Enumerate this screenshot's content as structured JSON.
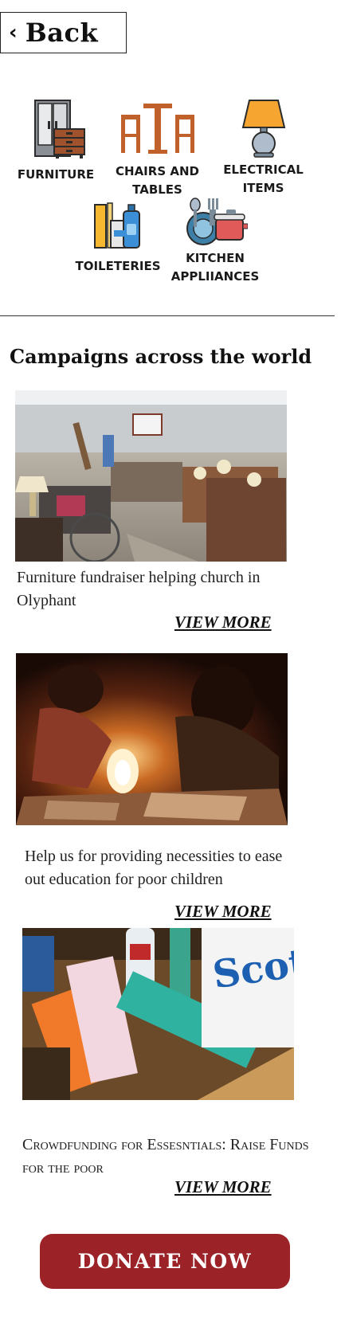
{
  "header": {
    "back_label": "Back"
  },
  "categories": [
    {
      "label": "FURNITURE",
      "icon": "furniture-icon"
    },
    {
      "label": "CHAIRS AND\nTABLES",
      "icon": "chairs-tables-icon"
    },
    {
      "label": "ELECTRICAL\nITEMS",
      "icon": "lamp-icon"
    },
    {
      "label": "TOILETERIES",
      "icon": "toiletries-icon"
    },
    {
      "label": "KITCHEN\nAPPLIIANCES",
      "icon": "kitchen-icon"
    }
  ],
  "campaigns_title": "Campaigns across the world",
  "campaigns": [
    {
      "text": "Furniture fundraiser helping church in Olyphant",
      "view_more": "VIEW MORE"
    },
    {
      "text": "Help us for providing necessities to ease out education for poor children",
      "view_more": "VIEW MORE"
    },
    {
      "text": "Crowdfunding for  Essesntials: Raise Funds for the poor",
      "view_more": "VIEW MORE"
    }
  ],
  "donate_label": "DONATE  NOW",
  "colors": {
    "donate_button": "#9b2226",
    "text": "#111111"
  }
}
